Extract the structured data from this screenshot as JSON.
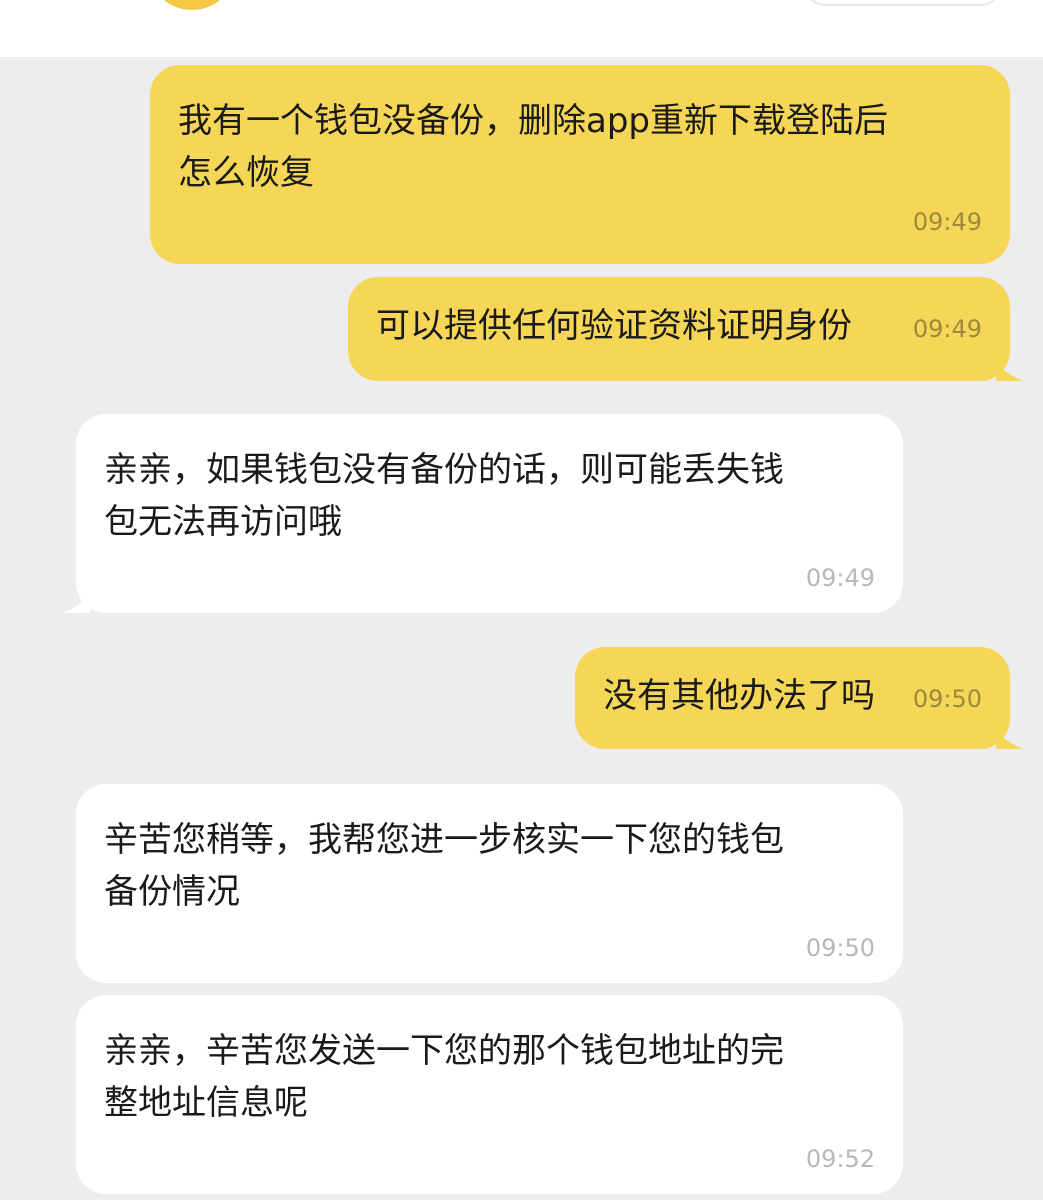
{
  "messages": [
    {
      "side": "out",
      "lines": [
        "我有一个钱包没备份，删除app重新下载登陆后",
        "怎么恢复"
      ],
      "time": "09:49"
    },
    {
      "side": "out",
      "lines": [
        "可以提供任何验证资料证明身份"
      ],
      "time": "09:49"
    },
    {
      "side": "in",
      "lines": [
        "亲亲，如果钱包没有备份的话，则可能丢失钱",
        "包无法再访问哦"
      ],
      "time": "09:49"
    },
    {
      "side": "out",
      "lines": [
        "没有其他办法了吗"
      ],
      "time": "09:50"
    },
    {
      "side": "in",
      "lines": [
        "辛苦您稍等，我帮您进一步核实一下您的钱包",
        "备份情况"
      ],
      "time": "09:50"
    },
    {
      "side": "in",
      "lines": [
        "亲亲，辛苦您发送一下您的那个钱包地址的完",
        "整地址信息呢"
      ],
      "time": "09:52"
    }
  ],
  "colors": {
    "outgoing_bubble": "#f5d657",
    "incoming_bubble": "#ffffff",
    "chat_background": "#ededed",
    "avatar": "#f5c842"
  }
}
